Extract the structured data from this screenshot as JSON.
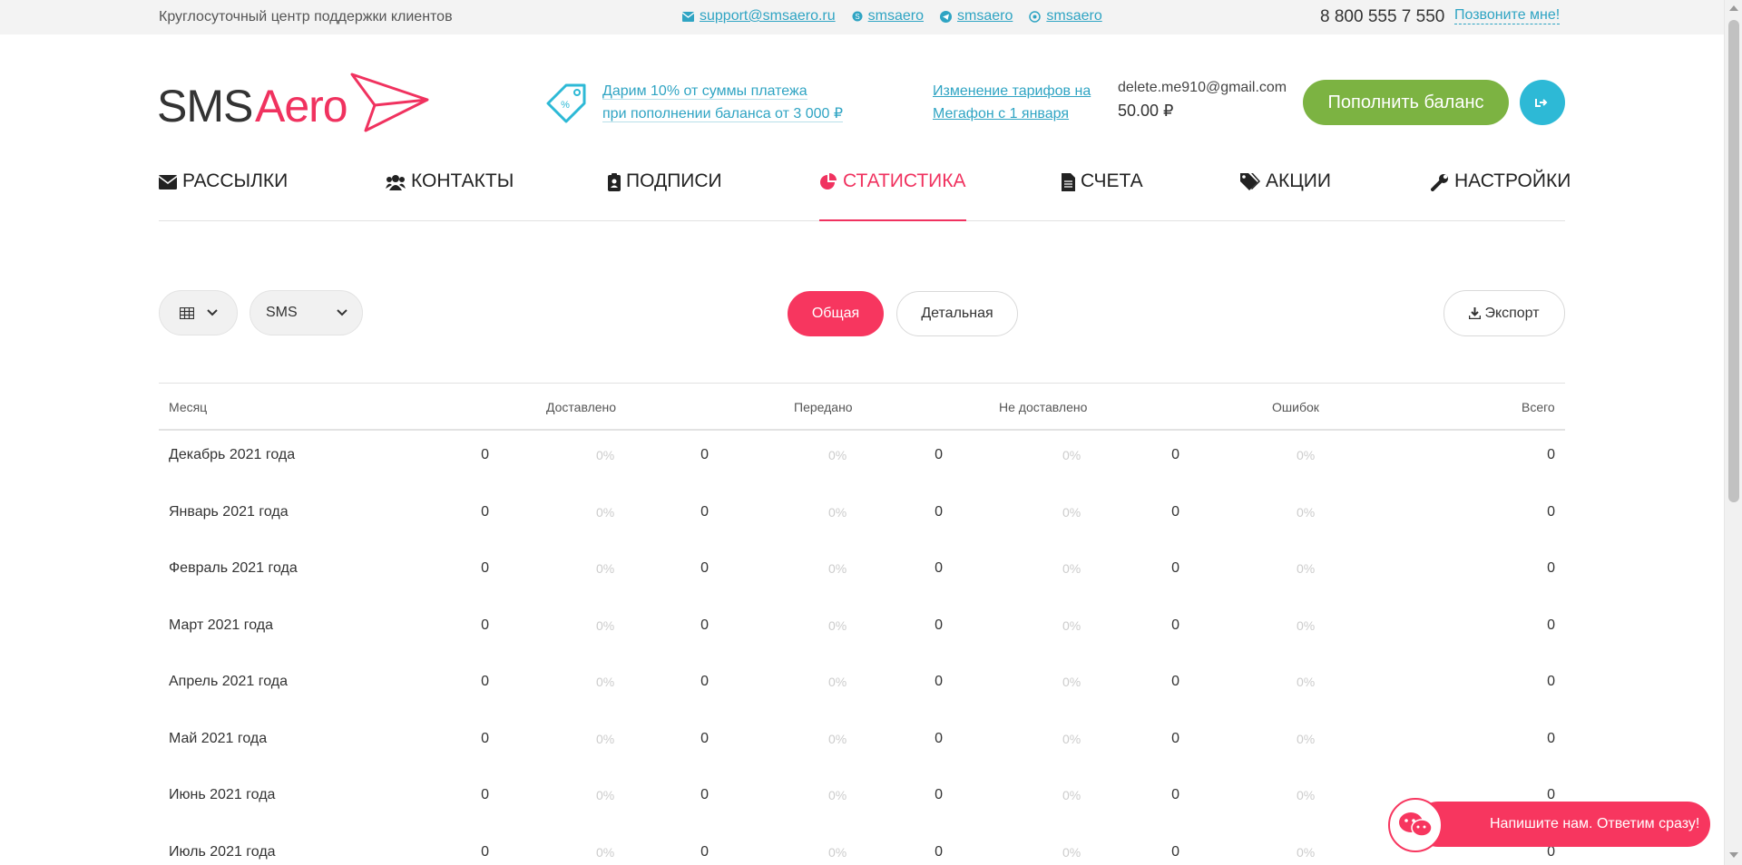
{
  "topbar": {
    "support_text": "Круглосуточный центр поддержки клиентов",
    "email": "support@smsaero.ru",
    "skype": "smsaero",
    "telegram": "smsaero",
    "whatsapp": "smsaero",
    "phone": "8 800 555 7 550",
    "callme": "Позвоните мне!"
  },
  "logo": {
    "sms": "SMS",
    "aero": "Aero"
  },
  "promo": {
    "line1": "Дарим 10% от суммы платежа",
    "line2": "при пополнении баланса от 3 000 ₽"
  },
  "tariff": {
    "line1": "Изменение тарифов на",
    "line2": "Мегафон с 1 января"
  },
  "account": {
    "email": "delete.me910@gmail.com",
    "balance": "50.00 ₽"
  },
  "topup_label": "Пополнить баланс",
  "nav": [
    {
      "label": "Рассылки",
      "icon": "envelope-icon"
    },
    {
      "label": "Контакты",
      "icon": "users-icon"
    },
    {
      "label": "Подписи",
      "icon": "badge-icon"
    },
    {
      "label": "Статистика",
      "icon": "pie-chart-icon",
      "active": true
    },
    {
      "label": "Счета",
      "icon": "file-icon"
    },
    {
      "label": "Акции",
      "icon": "tags-icon"
    },
    {
      "label": "Настройки",
      "icon": "wrench-icon"
    }
  ],
  "filters": {
    "channel": "SMS",
    "general": "Общая",
    "detailed": "Детальная",
    "export": "Экспорт"
  },
  "table": {
    "headers": [
      "Месяц",
      "Доставлено",
      "Передано",
      "Не доставлено",
      "Ошибок",
      "Всего"
    ],
    "rows": [
      {
        "month": "Декабрь 2021 года",
        "delivered": "0",
        "delivered_pct": "0%",
        "sent": "0",
        "sent_pct": "0%",
        "undelivered": "0",
        "undelivered_pct": "0%",
        "errors": "0",
        "errors_pct": "0%",
        "total": "0"
      },
      {
        "month": "Январь 2021 года",
        "delivered": "0",
        "delivered_pct": "0%",
        "sent": "0",
        "sent_pct": "0%",
        "undelivered": "0",
        "undelivered_pct": "0%",
        "errors": "0",
        "errors_pct": "0%",
        "total": "0"
      },
      {
        "month": "Февраль 2021 года",
        "delivered": "0",
        "delivered_pct": "0%",
        "sent": "0",
        "sent_pct": "0%",
        "undelivered": "0",
        "undelivered_pct": "0%",
        "errors": "0",
        "errors_pct": "0%",
        "total": "0"
      },
      {
        "month": "Март 2021 года",
        "delivered": "0",
        "delivered_pct": "0%",
        "sent": "0",
        "sent_pct": "0%",
        "undelivered": "0",
        "undelivered_pct": "0%",
        "errors": "0",
        "errors_pct": "0%",
        "total": "0"
      },
      {
        "month": "Апрель 2021 года",
        "delivered": "0",
        "delivered_pct": "0%",
        "sent": "0",
        "sent_pct": "0%",
        "undelivered": "0",
        "undelivered_pct": "0%",
        "errors": "0",
        "errors_pct": "0%",
        "total": "0"
      },
      {
        "month": "Май 2021 года",
        "delivered": "0",
        "delivered_pct": "0%",
        "sent": "0",
        "sent_pct": "0%",
        "undelivered": "0",
        "undelivered_pct": "0%",
        "errors": "0",
        "errors_pct": "0%",
        "total": "0"
      },
      {
        "month": "Июнь 2021 года",
        "delivered": "0",
        "delivered_pct": "0%",
        "sent": "0",
        "sent_pct": "0%",
        "undelivered": "0",
        "undelivered_pct": "0%",
        "errors": "0",
        "errors_pct": "0%",
        "total": "0"
      },
      {
        "month": "Июль 2021 года",
        "delivered": "0",
        "delivered_pct": "0%",
        "sent": "0",
        "sent_pct": "0%",
        "undelivered": "0",
        "undelivered_pct": "0%",
        "errors": "0",
        "errors_pct": "0%",
        "total": "0"
      }
    ]
  },
  "chat_label": "Напишите нам. Ответим сразу!",
  "colors": {
    "accent": "#f0325f",
    "link": "#2fa4c3",
    "green": "#7cb342",
    "cyan": "#2db9d6"
  }
}
